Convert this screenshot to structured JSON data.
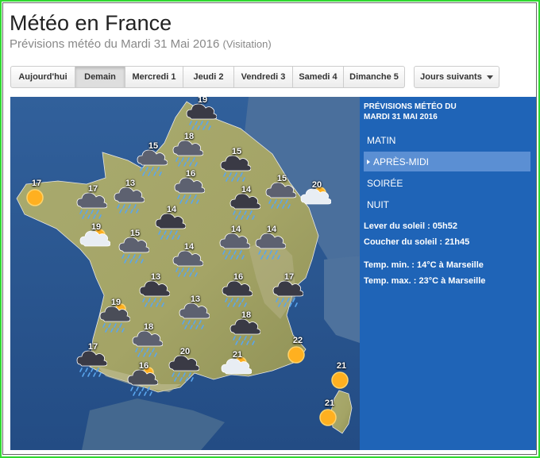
{
  "page": {
    "title": "Météo en France",
    "subtitle": "Prévisions météo du Mardi 31 Mai 2016",
    "visits": "(Visitation)"
  },
  "tabs": [
    {
      "label": "Aujourd'hui",
      "active": false
    },
    {
      "label": "Demain",
      "active": true
    },
    {
      "label": "Mercredi 1",
      "active": false
    },
    {
      "label": "Jeudi 2",
      "active": false
    },
    {
      "label": "Vendredi 3",
      "active": false
    },
    {
      "label": "Samedi 4",
      "active": false
    },
    {
      "label": "Dimanche 5",
      "active": false
    }
  ],
  "next_days": {
    "label": "Jours suivants",
    "icon": "caret-down-icon"
  },
  "panel": {
    "title_line1": "PRÉVISIONS MÉTÉO DU",
    "title_line2": "MARDI 31 MAI 2016",
    "periods": [
      {
        "label": "MATIN",
        "active": false
      },
      {
        "label": "APRÈS-MIDI",
        "active": true
      },
      {
        "label": "SOIRÉE",
        "active": false
      },
      {
        "label": "NUIT",
        "active": false
      }
    ],
    "sunrise": "Lever du soleil : 05h52",
    "sunset": "Coucher du soleil : 21h45",
    "temp_min": "Temp. min. : 14°C à Marseille",
    "temp_max": "Temp. max. : 23°C à Marseille"
  },
  "colors": {
    "sea": "#2b5a93",
    "land": "#a6a66a",
    "panel": "#1f64b7",
    "active_period": "#5b8fd3",
    "sun": "#ffb020",
    "storm_cloud": "#3a3a45",
    "rain": "#5aa6ee",
    "frame": "#2fd92f"
  },
  "forecasts": [
    {
      "temp": "19",
      "icon": "storm-cloud-icon"
    },
    {
      "temp": "18",
      "icon": "rain-cloud-icon"
    },
    {
      "temp": "15",
      "icon": "rain-cloud-icon"
    },
    {
      "temp": "15",
      "icon": "storm-cloud-icon"
    },
    {
      "temp": "16",
      "icon": "rain-cloud-icon"
    },
    {
      "temp": "17",
      "icon": "sun-icon"
    },
    {
      "temp": "17",
      "icon": "rain-cloud-icon"
    },
    {
      "temp": "13",
      "icon": "rain-cloud-icon"
    },
    {
      "temp": "15",
      "icon": "rain-cloud-icon"
    },
    {
      "temp": "14",
      "icon": "storm-cloud-icon"
    },
    {
      "temp": "20",
      "icon": "sun-cloud-icon"
    },
    {
      "temp": "14",
      "icon": "storm-cloud-icon"
    },
    {
      "temp": "19",
      "icon": "sun-cloud-icon"
    },
    {
      "temp": "15",
      "icon": "rain-cloud-icon"
    },
    {
      "temp": "14",
      "icon": "rain-cloud-icon"
    },
    {
      "temp": "14",
      "icon": "rain-cloud-icon"
    },
    {
      "temp": "14",
      "icon": "rain-cloud-icon"
    },
    {
      "temp": "13",
      "icon": "storm-cloud-icon"
    },
    {
      "temp": "16",
      "icon": "storm-cloud-icon"
    },
    {
      "temp": "17",
      "icon": "storm-cloud-icon"
    },
    {
      "temp": "19",
      "icon": "sun-rain-icon"
    },
    {
      "temp": "13",
      "icon": "rain-cloud-icon"
    },
    {
      "temp": "18",
      "icon": "rain-cloud-icon"
    },
    {
      "temp": "18",
      "icon": "storm-cloud-icon"
    },
    {
      "temp": "22",
      "icon": "sun-icon"
    },
    {
      "temp": "17",
      "icon": "storm-cloud-icon"
    },
    {
      "temp": "20",
      "icon": "storm-cloud-icon"
    },
    {
      "temp": "21",
      "icon": "sun-cloud-icon"
    },
    {
      "temp": "16",
      "icon": "sun-rain-icon"
    },
    {
      "temp": "21",
      "icon": "sun-icon"
    },
    {
      "temp": "21",
      "icon": "sun-icon"
    }
  ]
}
